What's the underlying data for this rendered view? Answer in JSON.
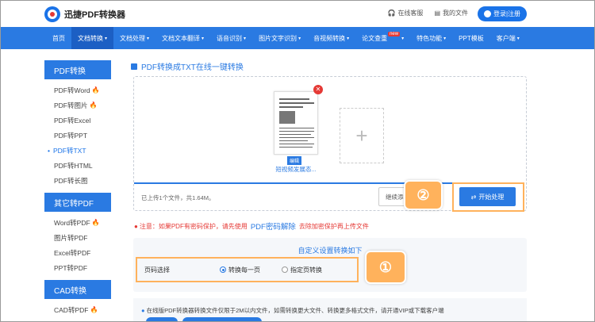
{
  "brand": {
    "name": "迅捷PDF转换器"
  },
  "topbar": {
    "service": "在线客服",
    "my_files": "我的文件",
    "login": "登录|注册"
  },
  "nav": [
    {
      "label": "首页"
    },
    {
      "label": "文档转换",
      "caret": "▾",
      "active": true
    },
    {
      "label": "文档处理",
      "caret": "▾"
    },
    {
      "label": "文档文本翻译",
      "caret": "▾"
    },
    {
      "label": "语音识别",
      "caret": "▾"
    },
    {
      "label": "图片文字识别",
      "caret": "▾"
    },
    {
      "label": "音视频转换",
      "caret": "▾"
    },
    {
      "label": "论文查重",
      "caret": "▾",
      "badge": "new"
    },
    {
      "label": "特色功能",
      "caret": "▾"
    },
    {
      "label": "PPT模板"
    },
    {
      "label": "客户端",
      "caret": "▾"
    }
  ],
  "sidebar": [
    {
      "title": "PDF转换",
      "items": [
        {
          "label": "PDF转Word",
          "hot": true
        },
        {
          "label": "PDF转图片",
          "hot": true
        },
        {
          "label": "PDF转Excel"
        },
        {
          "label": "PDF转PPT"
        },
        {
          "label": "PDF转TXT",
          "active": true
        },
        {
          "label": "PDF转HTML"
        },
        {
          "label": "PDF转长图"
        }
      ]
    },
    {
      "title": "其它转PDF",
      "items": [
        {
          "label": "Word转PDF",
          "hot": true
        },
        {
          "label": "图片转PDF"
        },
        {
          "label": "Excel转PDF"
        },
        {
          "label": "PPT转PDF"
        }
      ]
    },
    {
      "title": "CAD转换",
      "items": [
        {
          "label": "CAD转PDF",
          "hot": true
        }
      ]
    }
  ],
  "main": {
    "title": "PDF转换成TXT在线一键转换",
    "file": {
      "edit_tag": "编辑",
      "name": "短视频发展态..."
    },
    "upload_info": "已上传1个文件，共1.64M。",
    "continue_label": "继续添",
    "start_label": "开始处理",
    "notice": {
      "prefix": "注意：如果PDF有密码保护，请先使用",
      "link": "PDF密码解除",
      "suffix": "去除加密保护再上传文件"
    },
    "settings": {
      "title": "自定义设置转换如下",
      "row_label": "页码选择",
      "options": [
        {
          "label": "转换每一页",
          "selected": true
        },
        {
          "label": "指定页转换",
          "selected": false
        }
      ]
    },
    "bottom_notice": "在线版PDF转换器转换文件仅限于2M以内文件，如需转换更大文件、转换更多格式文件，请开通VIP或下载客户端"
  },
  "annotations": {
    "step1": "①",
    "step2": "②"
  },
  "colors": {
    "primary": "#2a7ae2",
    "highlight": "#ffb25c",
    "warning": "#e53935"
  }
}
